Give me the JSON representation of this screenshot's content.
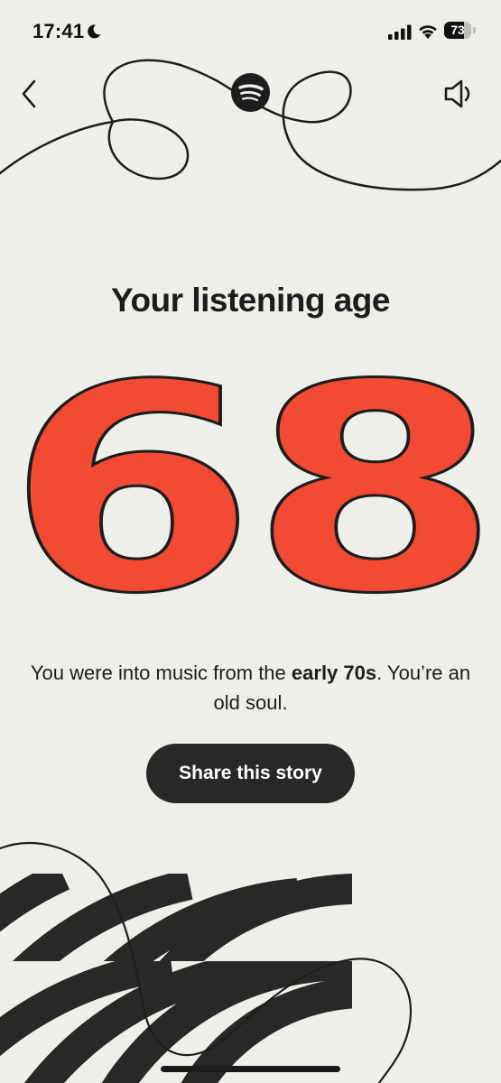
{
  "status_bar": {
    "time": "17:41",
    "battery_level": "73",
    "battery_fraction": 0.73,
    "icons": [
      "moon-icon",
      "signal-icon",
      "wifi-icon",
      "battery-icon"
    ]
  },
  "header": {
    "icons": [
      "back-chevron-icon",
      "spotify-logo-icon",
      "volume-icon"
    ]
  },
  "story": {
    "title": "Your listening age",
    "age": "68",
    "description_prefix": "You were into music from the ",
    "description_bold": "early 70s",
    "description_suffix": ". You’re an old soul.",
    "share_label": "Share this story"
  },
  "colors": {
    "background": "#efefea",
    "accent_red": "#f24a33",
    "dark": "#282828"
  }
}
